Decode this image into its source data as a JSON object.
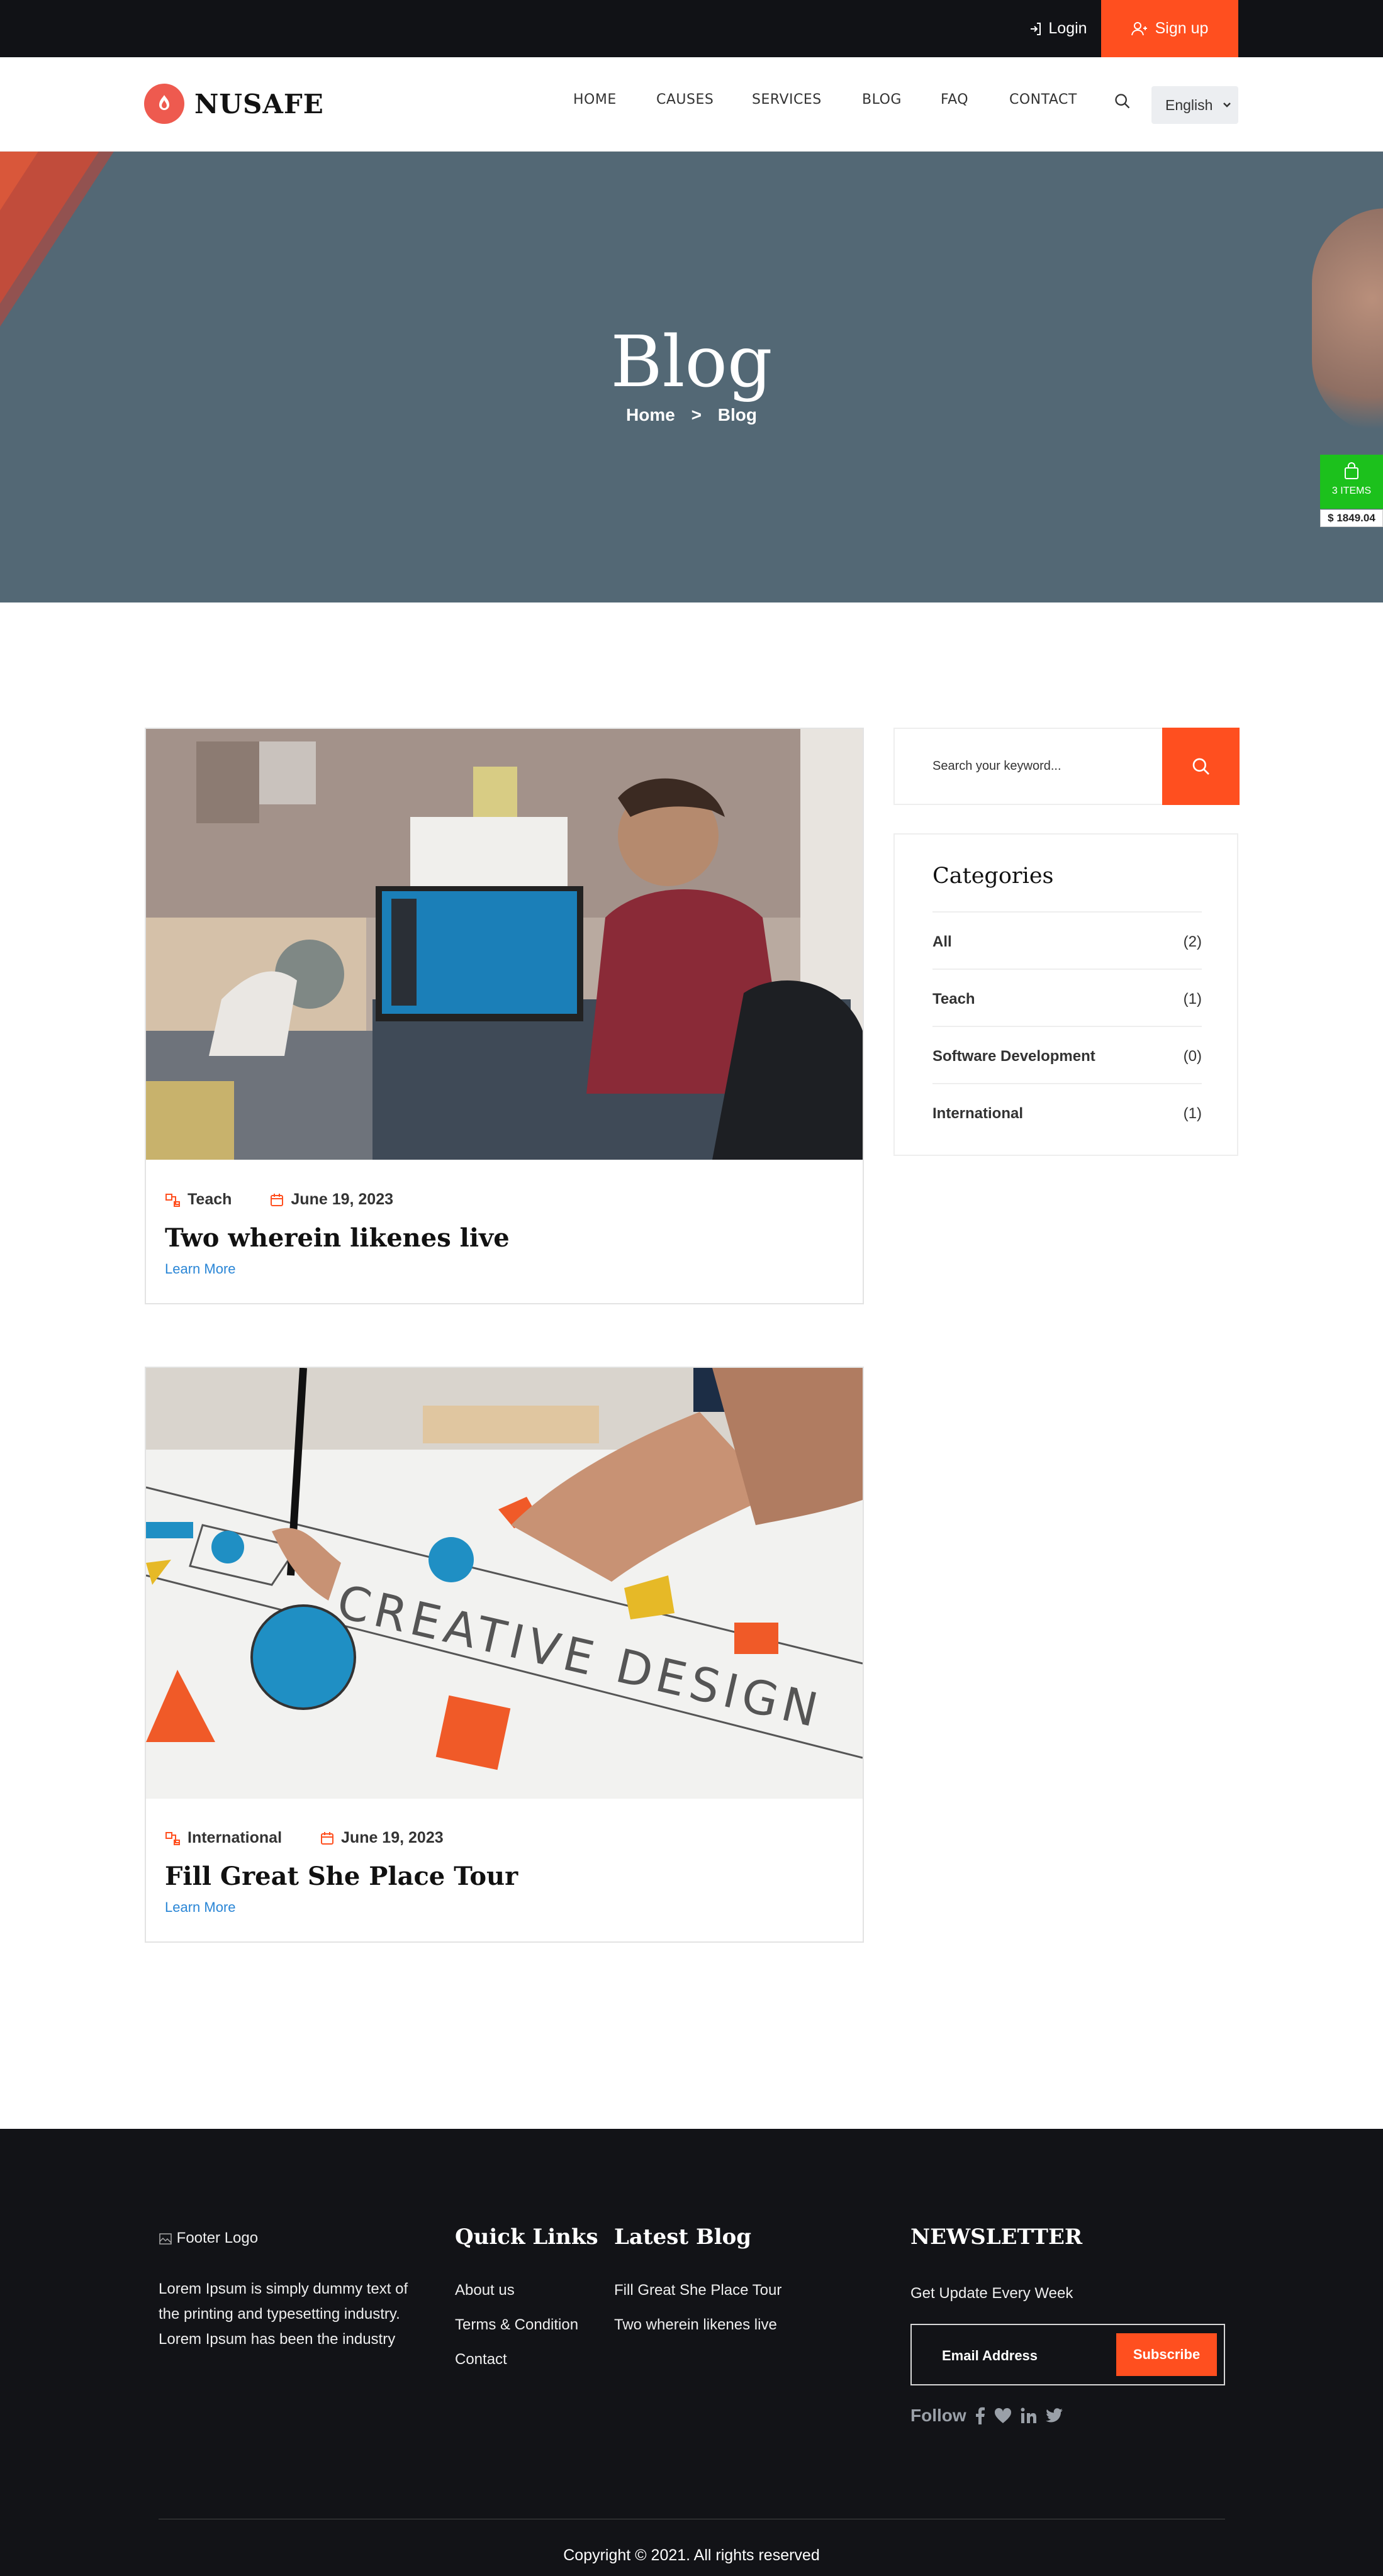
{
  "topbar": {
    "login": "Login",
    "signup": "Sign up"
  },
  "header": {
    "logo_text": "NUSAFE",
    "nav": [
      "HOME",
      "CAUSES",
      "SERVICES",
      "BLOG",
      "FAQ",
      "CONTACT"
    ],
    "language": "English"
  },
  "hero": {
    "title": "Blog",
    "crumb_home": "Home",
    "crumb_sep": ">",
    "crumb_current": "Blog"
  },
  "cart": {
    "items": "3 ITEMS",
    "price": "$ 1849.04"
  },
  "posts": [
    {
      "category": "Teach",
      "date": "June 19, 2023",
      "title": "Two wherein likenes live",
      "link": "Learn More"
    },
    {
      "category": "International",
      "date": "June 19, 2023",
      "title": "Fill Great She Place Tour",
      "link": "Learn More"
    }
  ],
  "sidebar": {
    "search_placeholder": "Search your keyword...",
    "categories_title": "Categories",
    "categories": [
      {
        "name": "All",
        "count": "(2)"
      },
      {
        "name": "Teach",
        "count": "(1)"
      },
      {
        "name": "Software Development",
        "count": "(0)"
      },
      {
        "name": "International",
        "count": "(1)"
      }
    ]
  },
  "footer": {
    "logo_alt": "Footer Logo",
    "about": "Lorem Ipsum is simply dummy text of the printing and typesetting industry. Lorem Ipsum has been the industry",
    "quick_title": "Quick Links",
    "quick_links": [
      "About us",
      "Terms & Condition",
      "Contact"
    ],
    "blog_title": "Latest Blog",
    "blog_links": [
      "Fill Great She Place Tour",
      "Two wherein likenes live"
    ],
    "news_title": "NEWSLETTER",
    "news_sub": "Get Update Every Week",
    "email_placeholder": "Email Address",
    "subscribe": "Subscribe",
    "follow": "Follow",
    "copyright": "Copyright © 2021. All rights reserved"
  },
  "colors": {
    "accent": "#ff4f1f",
    "dark": "#111216",
    "hero": "#536875",
    "cart": "#1cc11c",
    "link": "#2a86d6"
  }
}
